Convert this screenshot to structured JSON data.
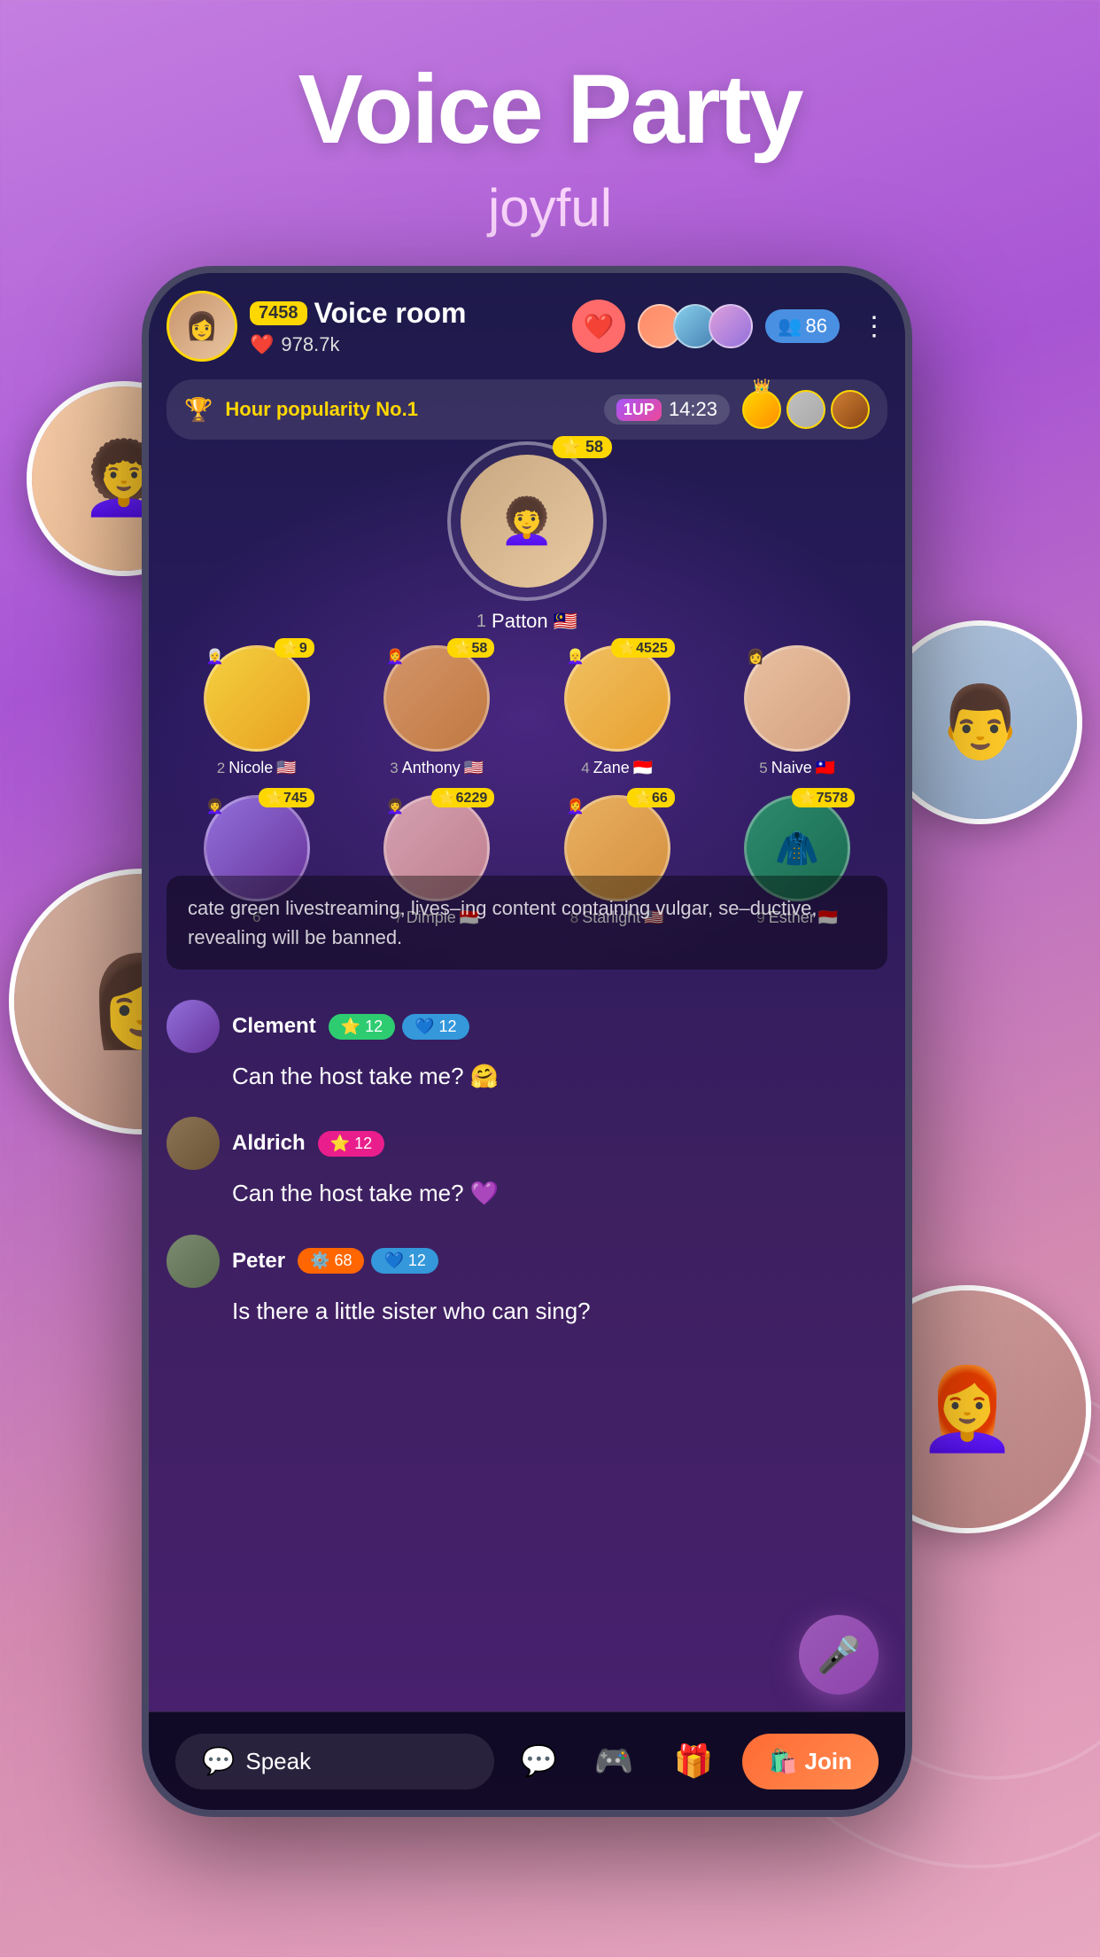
{
  "hero": {
    "title": "Voice Party",
    "subtitle": "joyful"
  },
  "room": {
    "name": "Voice room",
    "followers": "978.7k",
    "host_score": "7458",
    "viewer_count": "86",
    "popularity_label": "Hour popularity No.1",
    "timer": "14:23"
  },
  "host": {
    "name": "Patton",
    "pos": "1",
    "flag": "🇲🇾",
    "score": "58"
  },
  "participants": [
    {
      "pos": "2",
      "name": "Nicole",
      "flag": "🇺🇸",
      "score": "9",
      "style": "pav-nicole"
    },
    {
      "pos": "3",
      "name": "Anthony",
      "flag": "🇺🇸",
      "score": "58",
      "style": "pav-anthony"
    },
    {
      "pos": "4",
      "name": "Zane",
      "flag": "🇮🇩",
      "score": "4525",
      "style": "pav-zane"
    },
    {
      "pos": "5",
      "name": "Naive",
      "flag": "🇹🇼",
      "score": "",
      "style": "pav-naive"
    },
    {
      "pos": "7",
      "name": "Dimple",
      "flag": "🇮🇩",
      "score": "6229",
      "style": "pav-dimple"
    },
    {
      "pos": "8",
      "name": "Starlight",
      "flag": "🇺🇸",
      "score": "66",
      "style": "pav-starlight"
    },
    {
      "pos": "9",
      "name": "Esther",
      "flag": "🇮🇩",
      "score": "7578",
      "style": "pav-esther"
    },
    {
      "pos": "6",
      "name": "",
      "flag": "",
      "score": "745",
      "style": "pav-nicole"
    }
  ],
  "notice": {
    "text": "cate green livestreaming, lives–ing content containing vulgar, se–ductive, revealing will be banned."
  },
  "chat": [
    {
      "username": "Clement",
      "avatar_style": "cav1",
      "badge1_icon": "⭐",
      "badge1_val": "12",
      "badge2_icon": "💙",
      "badge2_val": "12",
      "badge1_color": "badge-green",
      "badge2_color": "badge-blue",
      "message": "Can the host take me? 🤗"
    },
    {
      "username": "Aldrich",
      "avatar_style": "cav2",
      "badge1_icon": "⭐",
      "badge1_val": "12",
      "badge2_icon": "",
      "badge2_val": "",
      "badge1_color": "badge-pink",
      "badge2_color": "",
      "message": "Can the host take me? 💜"
    },
    {
      "username": "Peter",
      "avatar_style": "cav3",
      "badge1_icon": "⚙️",
      "badge1_val": "68",
      "badge2_icon": "💙",
      "badge2_val": "12",
      "badge1_color": "badge-orange",
      "badge2_color": "badge-blue",
      "message": "Is there a little sister who can sing?"
    }
  ],
  "bottom": {
    "speak_label": "Speak",
    "join_label": "Join"
  },
  "icons": {
    "speak": "💬",
    "chat": "💬",
    "mic": "🎤",
    "game": "🎮",
    "gift": "🎁",
    "gift2": "🛍️",
    "more": "⋮",
    "heart": "❤️",
    "star": "⭐",
    "crown": "👑",
    "trophy": "🏆",
    "shield": "🛡️"
  }
}
